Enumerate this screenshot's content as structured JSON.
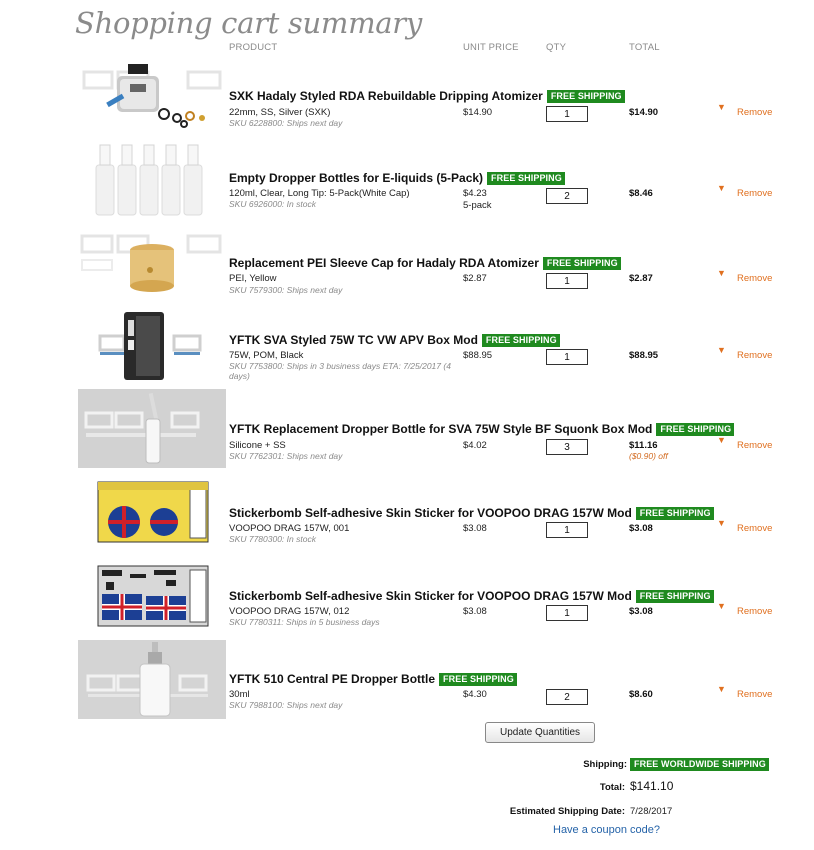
{
  "page_title": "Shopping cart summary",
  "columns": {
    "product": "PRODUCT",
    "unit_price": "UNIT PRICE",
    "qty": "QTY",
    "total": "TOTAL"
  },
  "colors": {
    "badge": "#1f8a1f",
    "remove": "#e07020",
    "link": "#2563a8",
    "title": "#8b8b8b"
  },
  "items": [
    {
      "name": "SXK Hadaly Styled RDA Rebuildable Dripping Atomizer",
      "badge": "FREE SHIPPING",
      "options": "22mm, SS, Silver (SXK)",
      "sku": "SKU 6228800: Ships next day",
      "unit_price": "$14.90",
      "unit_note": "",
      "qty": "1",
      "total": "$14.90",
      "discount": "",
      "remove": "Remove",
      "image": "rda-atomizer-silver"
    },
    {
      "name": "Empty Dropper Bottles for E-liquids (5-Pack)",
      "badge": "FREE SHIPPING",
      "options": "120ml, Clear, Long Tip: 5-Pack(White Cap)",
      "sku": "SKU 6926000: In stock",
      "unit_price": "$4.23",
      "unit_note": "5-pack",
      "qty": "2",
      "total": "$8.46",
      "discount": "",
      "remove": "Remove",
      "image": "dropper-bottles-5pack"
    },
    {
      "name": "Replacement PEI Sleeve Cap for Hadaly RDA Atomizer",
      "badge": "FREE SHIPPING",
      "options": "PEI, Yellow",
      "sku": "SKU 7579300: Ships next day",
      "unit_price": "$2.87",
      "unit_note": "",
      "qty": "1",
      "total": "$2.87",
      "discount": "",
      "remove": "Remove",
      "image": "pei-sleeve-cap-yellow"
    },
    {
      "name": "YFTK SVA Styled 75W TC VW APV Box Mod",
      "badge": "FREE SHIPPING",
      "options": "75W, POM, Black",
      "sku": "SKU 7753800: Ships in 3 business days ETA: 7/25/2017 (4 days)",
      "unit_price": "$88.95",
      "unit_note": "",
      "qty": "1",
      "total": "$88.95",
      "discount": "",
      "remove": "Remove",
      "image": "box-mod-black"
    },
    {
      "name": "YFTK Replacement Dropper Bottle for SVA 75W Style BF Squonk Box Mod",
      "badge": "FREE SHIPPING",
      "options": "Silicone + SS",
      "sku": "SKU 7762301: Ships next day",
      "unit_price": "$4.02",
      "unit_note": "",
      "qty": "3",
      "total": "$11.16",
      "discount": "($0.90) off",
      "remove": "Remove",
      "image": "squonk-bottle"
    },
    {
      "name": "Stickerbomb Self-adhesive Skin Sticker for VOOPOO DRAG 157W Mod",
      "badge": "FREE SHIPPING",
      "options": "VOOPOO DRAG 157W, 001",
      "sku": "SKU 7780300: In stock",
      "unit_price": "$3.08",
      "unit_note": "",
      "qty": "1",
      "total": "$3.08",
      "discount": "",
      "remove": "Remove",
      "image": "skin-sticker-yellow"
    },
    {
      "name": "Stickerbomb Self-adhesive Skin Sticker for VOOPOO DRAG 157W Mod",
      "badge": "FREE SHIPPING",
      "options": "VOOPOO DRAG 157W, 012",
      "sku": "SKU 7780311: Ships in 5 business days",
      "unit_price": "$3.08",
      "unit_note": "",
      "qty": "1",
      "total": "$3.08",
      "discount": "",
      "remove": "Remove",
      "image": "skin-sticker-unionjack"
    },
    {
      "name": "YFTK 510 Central PE Dropper Bottle",
      "badge": "FREE SHIPPING",
      "options": "30ml",
      "sku": "SKU 7988100: Ships next day",
      "unit_price": "$4.30",
      "unit_note": "",
      "qty": "2",
      "total": "$8.60",
      "discount": "",
      "remove": "Remove",
      "image": "pe-dropper-bottle"
    }
  ],
  "update_button": "Update Quantities",
  "summary": {
    "shipping_label": "Shipping:",
    "shipping_value": "FREE WORLDWIDE SHIPPING",
    "total_label": "Total:",
    "total_value": "$141.10",
    "est_label": "Estimated Shipping Date:",
    "est_value": "7/28/2017"
  },
  "coupon_link": "Have a coupon code?"
}
